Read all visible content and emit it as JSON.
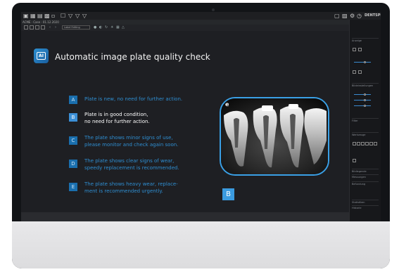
{
  "app": {
    "title_bar_text": "ACME · Case · 01.12.2020",
    "logo_text": "DENTSPLY",
    "toolbar_dropdown": "Label Editing"
  },
  "icons": {
    "topbar_left": [
      "grid-icon",
      "table-icon",
      "layout-icon",
      "image-icon",
      "doc-icon",
      "pen-icon",
      "triangle-icon",
      "triangle-icon",
      "triangle-icon"
    ],
    "topbar_right": [
      "export-icon",
      "share-icon",
      "settings-icon",
      "clock-icon"
    ]
  },
  "main": {
    "heading": "Automatic image plate quality check",
    "ai_badge": "AI",
    "items": [
      {
        "letter": "A",
        "lines": [
          "Plate is new, no need for further action."
        ],
        "active": false
      },
      {
        "letter": "B",
        "lines": [
          "Plate is in good condition,",
          "no need for further action."
        ],
        "active": true
      },
      {
        "letter": "C",
        "lines": [
          "The plate shows minor signs of use,",
          "please monitor and check again soon."
        ],
        "active": false
      },
      {
        "letter": "D",
        "lines": [
          "The plate shows clear signs of wear,",
          "speedy replacement is recommended."
        ],
        "active": false
      },
      {
        "letter": "E",
        "lines": [
          "The plate shows heavy wear, replace-",
          "ment is recommended urgently."
        ],
        "active": false
      }
    ],
    "xray_label": "e",
    "result_marker": "B"
  },
  "colors": {
    "accent": "#3b9be0",
    "item_text": "#2f8ed1",
    "background": "#1e1f23"
  },
  "panel": {
    "sections": [
      "Anzeige",
      "Bildeinstellungen",
      "Filter",
      "Werkzeuge",
      "Bildlegende",
      "Messungen",
      "Befundung",
      "Statistiken",
      "Historie"
    ]
  }
}
